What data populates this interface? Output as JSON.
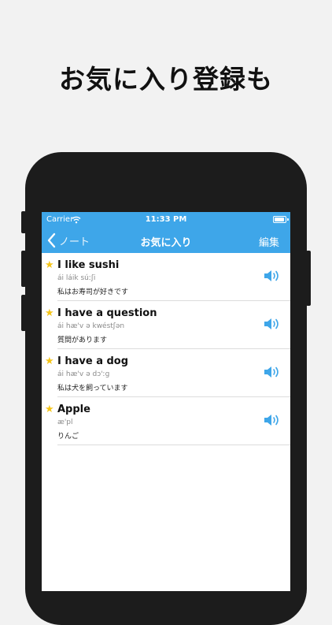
{
  "headline": "お気に入り登録も",
  "status_bar": {
    "carrier": "Carrier",
    "time": "11:33 PM",
    "battery_level": 0.9
  },
  "nav": {
    "back_label": "ノート",
    "title": "お気に入り",
    "edit_label": "編集"
  },
  "favorites": [
    {
      "phrase": "I like sushi",
      "ipa": "ái láik súːʃi",
      "translation": "私はお寿司が好きです"
    },
    {
      "phrase": "I have a question",
      "ipa": "ái hæ'v ə kwéstʃən",
      "translation": "質問があります"
    },
    {
      "phrase": "I have a dog",
      "ipa": "ái hæ'v ə dɔ'ːg",
      "translation": "私は犬を飼っています"
    },
    {
      "phrase": "Apple",
      "ipa": "æ'pl",
      "translation": "りんご"
    }
  ],
  "colors": {
    "accent": "#3ea6e9",
    "star": "#f5c518",
    "speaker": "#3ea6e9"
  },
  "icons": {
    "back": "chevron-left-icon",
    "wifi": "wifi-icon",
    "battery": "battery-icon",
    "star": "star-icon",
    "speaker": "speaker-icon"
  }
}
